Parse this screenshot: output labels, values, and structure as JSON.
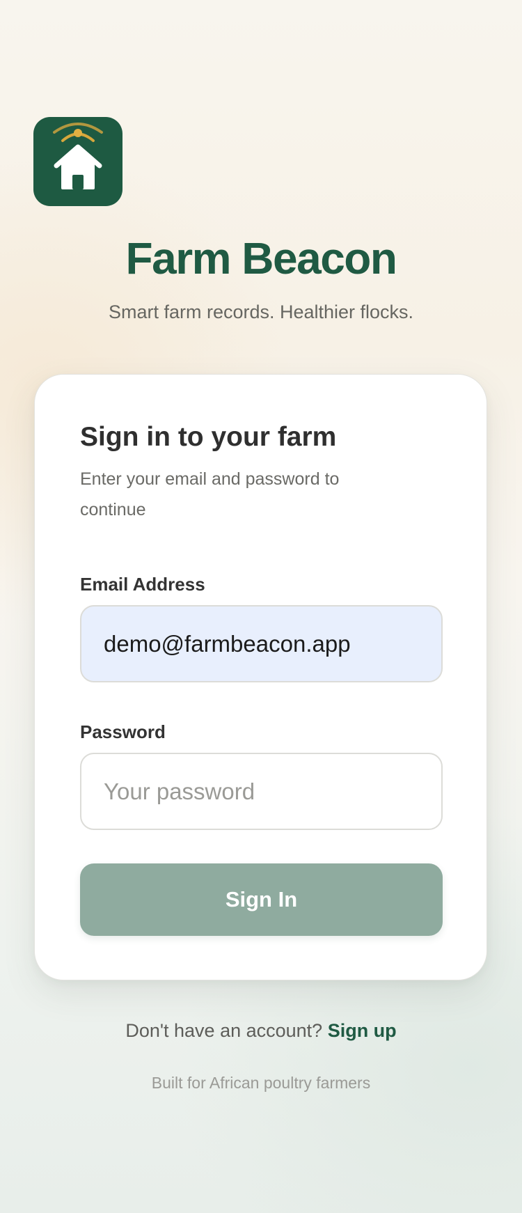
{
  "brand": {
    "logo_icon": "farm-house-signal-icon",
    "title": "Farm Beacon",
    "tagline": "Smart farm records. Healthier flocks."
  },
  "signin_card": {
    "title": "Sign in to your farm",
    "subtitle": "Enter your email and password to continue",
    "email": {
      "label": "Email Address",
      "value": "demo@farmbeacon.app"
    },
    "password": {
      "label": "Password",
      "placeholder": "Your password",
      "value": ""
    },
    "submit_label": "Sign In"
  },
  "signup": {
    "prompt": "Don't have an account? ",
    "link_label": "Sign up"
  },
  "footer": {
    "note": "Built for African poultry farmers"
  },
  "colors": {
    "brand_green": "#1f5a43",
    "logo_tile": "#1e5a42",
    "signal_gold": "#d7a73c",
    "button_disabled": "#8fab9f",
    "email_autofill_bg": "#e8effd"
  }
}
